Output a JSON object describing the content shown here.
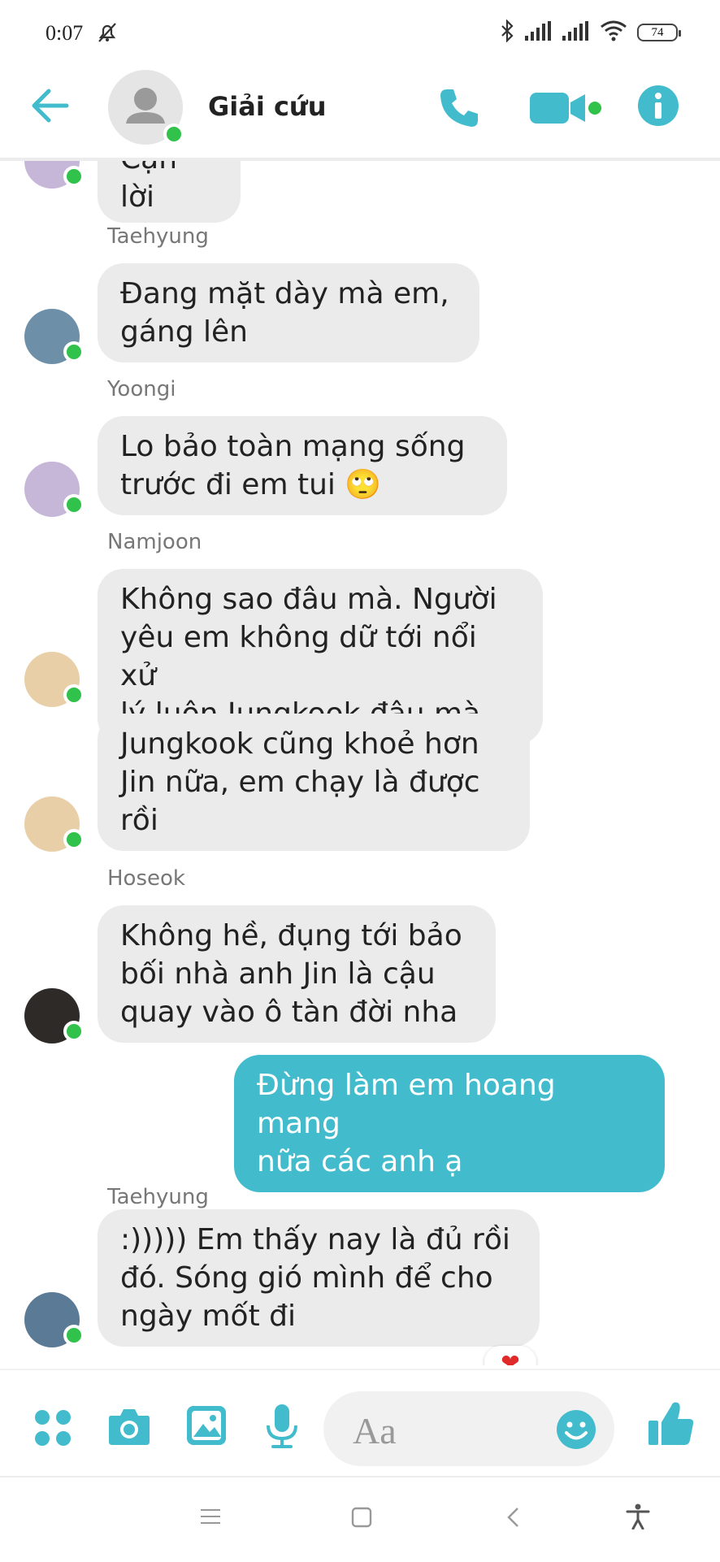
{
  "status_bar": {
    "time": "0:07",
    "battery": "74"
  },
  "header": {
    "title": "Giải cứu"
  },
  "messages": [
    {
      "sender": "",
      "text": "Cạn lời"
    },
    {
      "sender": "Taehyung",
      "text": "Đang mặt dày mà em,\ngáng lên"
    },
    {
      "sender": "Yoongi",
      "text": "Lo bảo toàn mạng sống\ntrước đi em tui 🙄"
    },
    {
      "sender": "Namjoon",
      "text": "Không sao đâu mà. Người\nyêu em không dữ tới nổi xử\nlý luôn Jungkook đâu mà"
    },
    {
      "sender": "",
      "text": "Jungkook cũng khoẻ hơn\nJin nữa, em chạy là được\nrồi"
    },
    {
      "sender": "Hoseok",
      "text": "Không hề, đụng tới bảo\nbối nhà anh Jin là cậu\nquay vào ô tàn đời nha"
    },
    {
      "sender": "",
      "text": "Đừng làm em hoang mang\nnữa các anh ạ"
    },
    {
      "sender": "Taehyung",
      "text": ":))))) Em thấy nay là đủ rồi\nđó. Sóng gió mình để cho\nngày mốt đi"
    }
  ],
  "reaction": "❤",
  "composer": {
    "placeholder": "Aa"
  },
  "colors": {
    "accent": "#42bccd",
    "online": "#30c24b",
    "bubble_other": "#ebebeb"
  },
  "icons": [
    "back-arrow-icon",
    "phone-icon",
    "video-icon",
    "info-icon",
    "apps-icon",
    "camera-icon",
    "gallery-icon",
    "microphone-icon",
    "emoji-icon",
    "thumbs-up-icon",
    "menu-icon",
    "home-icon",
    "back-icon",
    "accessibility-icon"
  ]
}
